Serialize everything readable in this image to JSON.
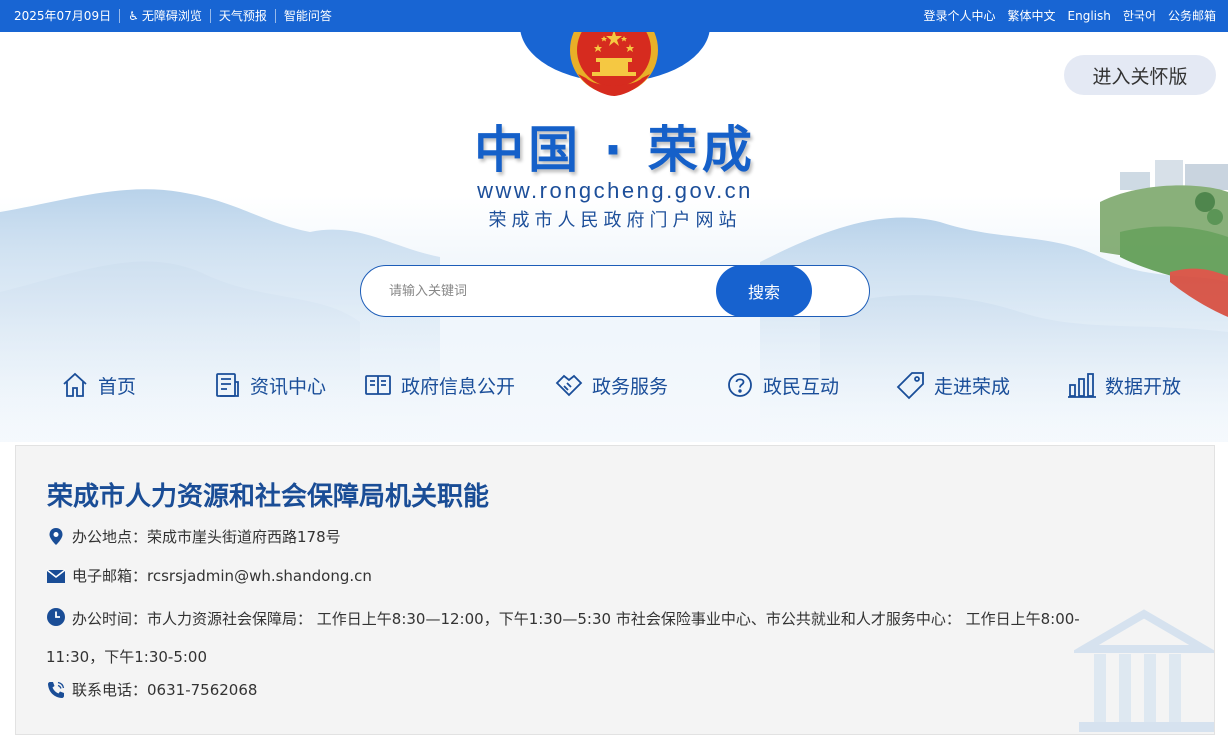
{
  "topbar": {
    "date": "2025年07月09日",
    "accessibility": "无障碍浏览",
    "weather": "天气预报",
    "qa": "智能问答",
    "login": "登录个人中心",
    "traditional": "繁体中文",
    "english": "English",
    "korean": "한국어",
    "mail": "公务邮箱"
  },
  "care_mode": "进入关怀版",
  "site": {
    "title": "中国 · 荣成",
    "url": "www.rongcheng.gov.cn",
    "subtitle": "荣成市人民政府门户网站"
  },
  "search": {
    "placeholder": "请输入关键词",
    "button": "搜索"
  },
  "nav": [
    {
      "label": "首页",
      "icon": "home-icon"
    },
    {
      "label": "资讯中心",
      "icon": "news-icon"
    },
    {
      "label": "政府信息公开",
      "icon": "book-icon"
    },
    {
      "label": "政务服务",
      "icon": "handshake-icon"
    },
    {
      "label": "政民互动",
      "icon": "question-icon"
    },
    {
      "label": "走进荣成",
      "icon": "tag-icon"
    },
    {
      "label": "数据开放",
      "icon": "bar-chart-icon"
    }
  ],
  "info": {
    "title": "荣成市人力资源和社会保障局机关职能",
    "address_label": "办公地点：",
    "address": "荣成市崖头街道府西路178号",
    "email_label": "电子邮箱：",
    "email": "rcsrsjadmin@wh.shandong.cn",
    "hours_label": "办公时间：",
    "hours": "市人力资源社会保障局：  工作日上午8:30—12:00，下午1:30—5:30 市社会保险事业中心、市公共就业和人才服务中心：  工作日上午8:00-11:30，下午1:30-5:00",
    "phone_label": "联系电话：",
    "phone": "0631-7562068"
  },
  "colors": {
    "topbar": "#1865d3",
    "accent": "#1762cf",
    "nav_text": "#1a4e99",
    "title_text": "#1a4d96"
  }
}
